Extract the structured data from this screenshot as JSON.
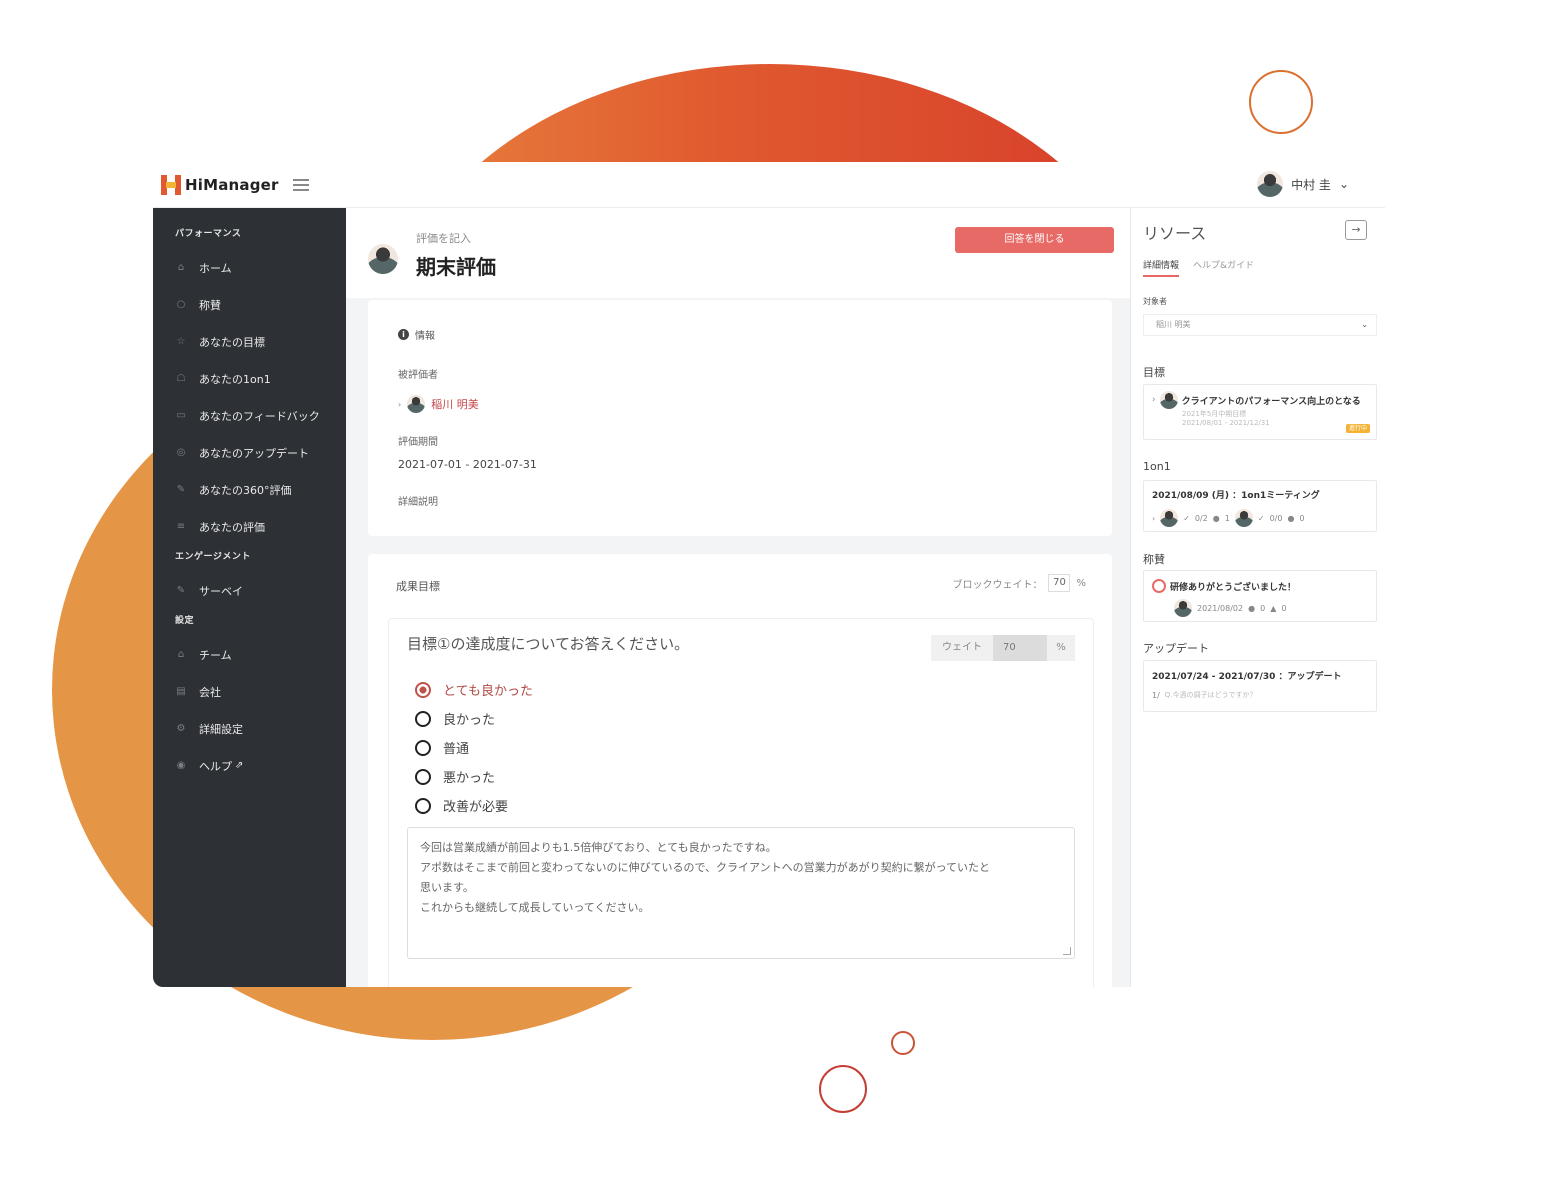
{
  "app": {
    "logo_text": "HiManager",
    "user_name": "中村 圭",
    "user_chevron": "⌄"
  },
  "sidebar": {
    "sections": [
      {
        "label": "パフォーマンス",
        "items": [
          {
            "label": "ホーム",
            "icon": "home-icon"
          },
          {
            "label": "称賛",
            "icon": "medal-icon"
          },
          {
            "label": "あなたの目標",
            "icon": "star-icon"
          },
          {
            "label": "あなたの1on1",
            "icon": "user-icon"
          },
          {
            "label": "あなたのフィードバック",
            "icon": "chat-icon"
          },
          {
            "label": "あなたのアップデート",
            "icon": "update-icon"
          },
          {
            "label": "あなたの360°評価",
            "icon": "edit-icon"
          },
          {
            "label": "あなたの評価",
            "icon": "list-icon"
          }
        ]
      },
      {
        "label": "エンゲージメント",
        "items": [
          {
            "label": "サーベイ",
            "icon": "survey-icon"
          }
        ]
      },
      {
        "label": "設定",
        "items": [
          {
            "label": "チーム",
            "icon": "team-icon"
          },
          {
            "label": "会社",
            "icon": "building-icon"
          },
          {
            "label": "詳細設定",
            "icon": "gears-icon"
          },
          {
            "label": "ヘルプ",
            "icon": "help-icon"
          }
        ]
      }
    ]
  },
  "header": {
    "subtitle": "評価を記入",
    "title": "期末評価",
    "close_button": "回答を閉じる"
  },
  "info": {
    "heading": "情報",
    "evaluatee_label": "被評価者",
    "evaluatee_name": "稲川 明美",
    "period_label": "評価期間",
    "period_value": "2021-07-01 - 2021-07-31",
    "description_label": "詳細説明"
  },
  "goals": {
    "title": "成果目標",
    "block_weight_label": "ブロックウェイト：",
    "block_weight_value": "70",
    "block_weight_unit": "%",
    "question": "目標①の達成度についてお答えください。",
    "weight_label": "ウェイト",
    "weight_value": "70",
    "weight_unit": "%",
    "options": [
      "とても良かった",
      "良かった",
      "普通",
      "悪かった",
      "改善が必要"
    ],
    "selected_index": 0,
    "comment_lines": [
      "今回は営業成績が前回よりも1.5倍伸びており、とても良かったですね。",
      "アポ数はそこまで前回と変わってないのに伸びているので、クライアントへの営業力があがり契約に繋がっていたと",
      "思います。",
      "これからも継続して成長していってください。"
    ]
  },
  "resources": {
    "title": "リソース",
    "expand_icon": "→",
    "tabs": [
      "詳細情報",
      "ヘルプ&ガイド"
    ],
    "target_label": "対象者",
    "target_value": "稲川 明美",
    "goal_label": "目標",
    "goal_title": "クライアントのパフォーマンス向上のとなる",
    "goal_sub1": "2021年5月中期目標",
    "goal_sub2": "2021/08/01 - 2021/12/31",
    "goal_badge": "進行中",
    "oneonone_label": "1on1",
    "oneonone_title": "2021/08/09 (月) ：1on1ミーティング",
    "oneonone_meta1": "0/2",
    "oneonone_meta2": "1",
    "oneonone_meta3": "0/0",
    "oneonone_meta4": "0",
    "praise_label": "称賛",
    "praise_title": "研修ありがとうございました！",
    "praise_date": "2021/08/02",
    "praise_comments": "0",
    "praise_likes": "0",
    "update_label": "アップデート",
    "update_title": "2021/07/24 - 2021/07/30 ：アップデート",
    "update_sub": "Q.今週の調子はどうですか？",
    "update_score": "1/"
  }
}
